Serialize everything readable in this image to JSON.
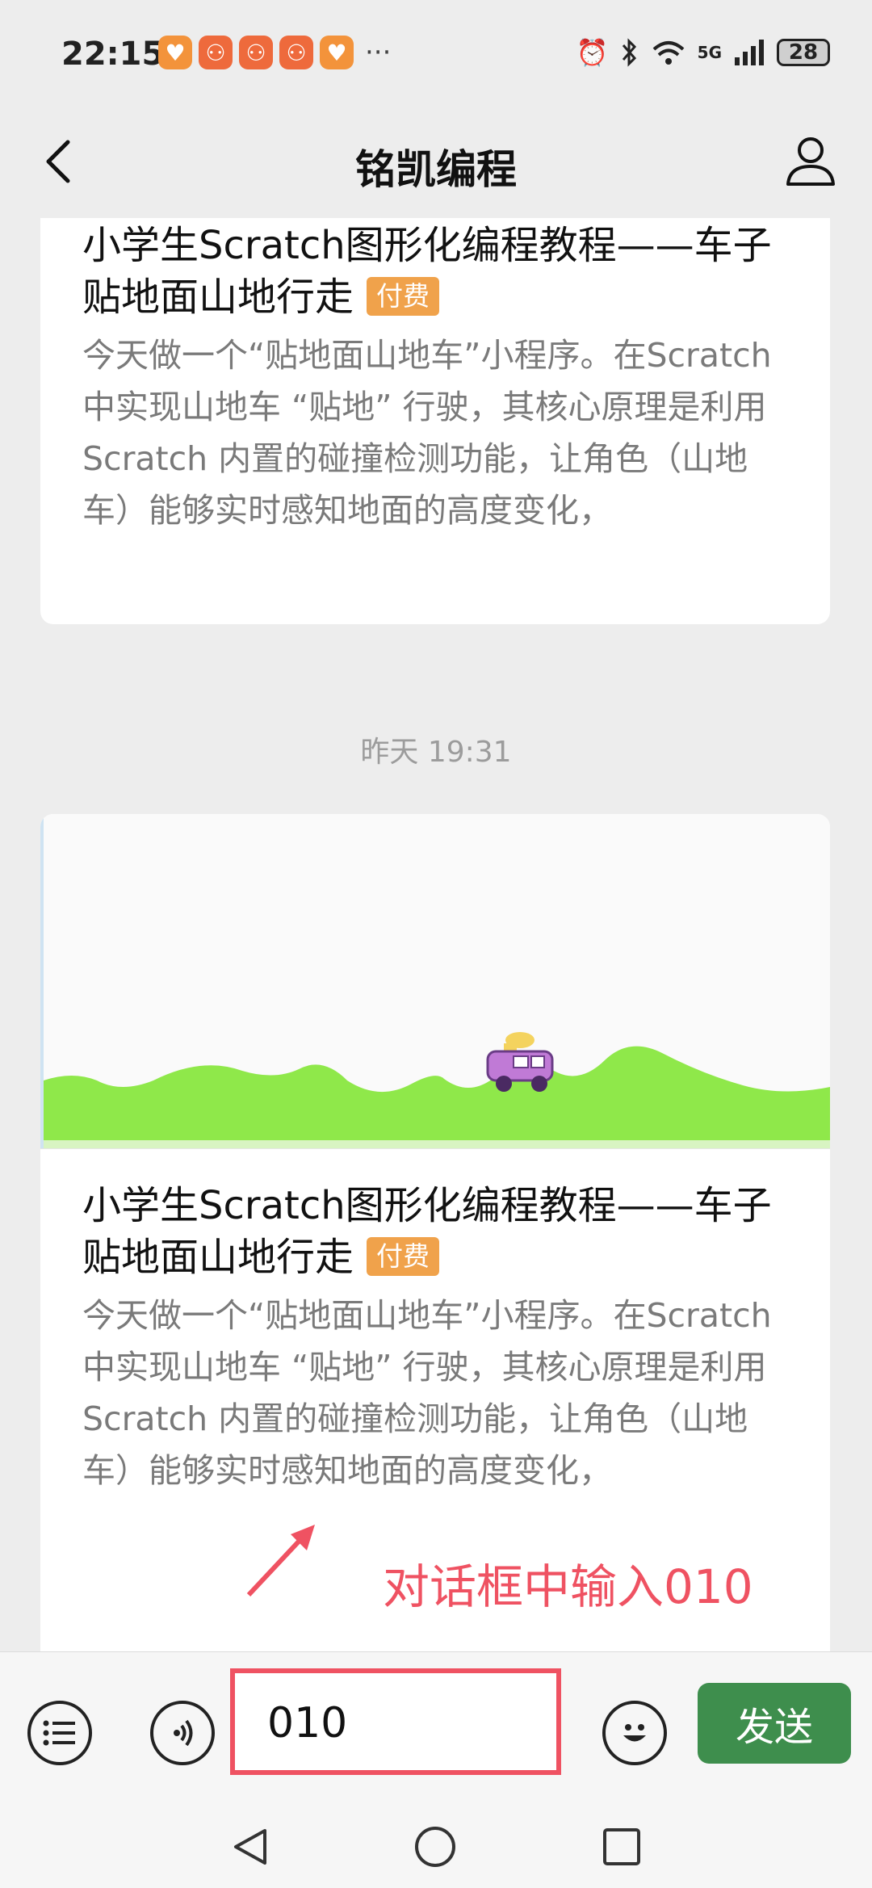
{
  "status_bar": {
    "time": "22:15",
    "battery": "28",
    "network": "5G"
  },
  "header": {
    "title": "铭凯编程"
  },
  "messages": [
    {
      "title": "小学生Scratch图形化编程教程——车子贴地面山地行走",
      "badge": "付费",
      "description": "今天做一个“贴地面山地车”小程序。在Scratch 中实现山地车 “贴地” 行驶，其核心原理是利用 Scratch 内置的碰撞检测功能，让角色（山地车）能够实时感知地面的高度变化，"
    },
    {
      "timestamp": "昨天 19:31",
      "title": "小学生Scratch图形化编程教程——车子贴地面山地行走",
      "badge": "付费",
      "description": "今天做一个“贴地面山地车”小程序。在Scratch 中实现山地车 “贴地” 行驶，其核心原理是利用 Scratch 内置的碰撞检测功能，让角色（山地车）能够实时感知地面的高度变化，"
    }
  ],
  "annotation": {
    "text": "对话框中输入010",
    "color": "#ef5262"
  },
  "input_bar": {
    "value": "010",
    "send_label": "发送"
  },
  "colors": {
    "badge": "#f0a24b",
    "send": "#3e8e4d",
    "ground": "#8fe84a",
    "highlight": "#ef5262"
  }
}
